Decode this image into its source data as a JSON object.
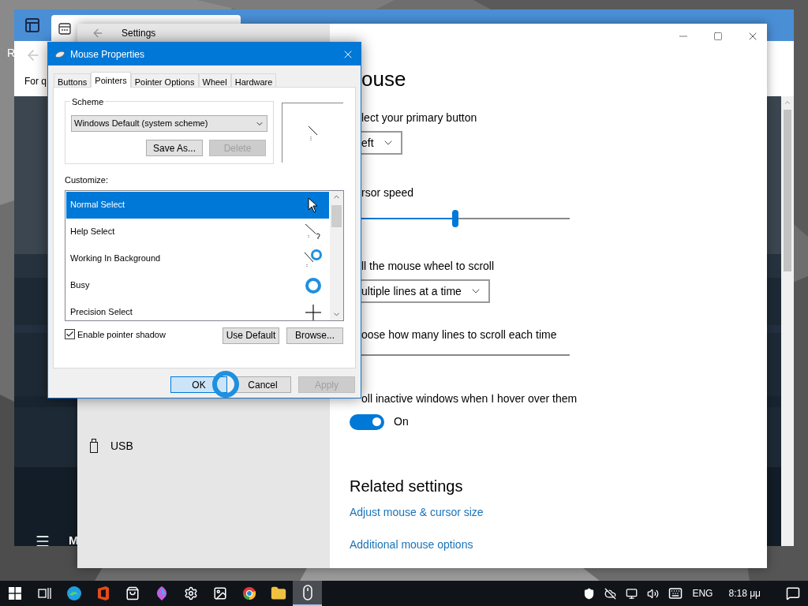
{
  "back_window": {
    "edge_letter": "R",
    "header_text": "For q",
    "bottom_label": "M"
  },
  "settings": {
    "title": "Settings",
    "sidebar": [
      {
        "label": "USB"
      }
    ],
    "heading": "ouse",
    "sections": [
      {
        "kind": "dropdown",
        "label": "lect your primary button",
        "value": "eft"
      },
      {
        "kind": "slider",
        "label": "rsor speed",
        "level": 0.45
      },
      {
        "kind": "dropdown",
        "label": "ll the mouse wheel to scroll",
        "value": "ultiple lines at a time"
      },
      {
        "kind": "track",
        "label": "oose how many lines to scroll each time"
      },
      {
        "kind": "toggle",
        "label": "oll inactive windows when I hover over them",
        "on": true,
        "state_text": "On"
      }
    ],
    "related": {
      "title": "Related settings",
      "links": [
        "Adjust mouse & cursor size",
        "Additional mouse options"
      ]
    }
  },
  "dialog": {
    "title": "Mouse Properties",
    "tabs": [
      {
        "label": "Buttons",
        "selected": false
      },
      {
        "label": "Pointers",
        "selected": true
      },
      {
        "label": "Pointer Options",
        "selected": false
      },
      {
        "label": "Wheel",
        "selected": false
      },
      {
        "label": "Hardware",
        "selected": false
      }
    ],
    "scheme": {
      "label": "Scheme",
      "value": "Windows Default (system scheme)",
      "buttons": [
        {
          "label": "Save As...",
          "disabled": false
        },
        {
          "label": "Delete",
          "disabled": true
        }
      ]
    },
    "customize_label": "Customize:",
    "pointers": [
      {
        "name": "Normal Select",
        "kind": "arrow",
        "selected": true
      },
      {
        "name": "Help Select",
        "kind": "help",
        "selected": false
      },
      {
        "name": "Working In Background",
        "kind": "working",
        "selected": false
      },
      {
        "name": "Busy",
        "kind": "busy",
        "selected": false
      },
      {
        "name": "Precision Select",
        "kind": "cross",
        "selected": false
      }
    ],
    "shadow": {
      "label": "Enable pointer shadow",
      "checked": true
    },
    "pointer_buttons": [
      {
        "label": "Use Default"
      },
      {
        "label": "Browse..."
      }
    ],
    "buttons": [
      {
        "label": "OK",
        "disabled": false,
        "focused": true
      },
      {
        "label": "Cancel",
        "disabled": false,
        "focused": false
      },
      {
        "label": "Apply",
        "disabled": true,
        "focused": false
      }
    ]
  },
  "taskbar": {
    "apps": [
      {
        "kind": "task-view",
        "active": false
      },
      {
        "kind": "browser",
        "active": false
      },
      {
        "kind": "office",
        "active": false
      },
      {
        "kind": "store",
        "active": false
      },
      {
        "kind": "paint",
        "active": false
      },
      {
        "kind": "settings",
        "active": false
      },
      {
        "kind": "photos",
        "active": false
      },
      {
        "kind": "chrome",
        "active": false
      },
      {
        "kind": "folder",
        "active": false
      },
      {
        "kind": "mouse",
        "active": true
      }
    ],
    "language": "ENG",
    "time": "8:18 μμ"
  }
}
